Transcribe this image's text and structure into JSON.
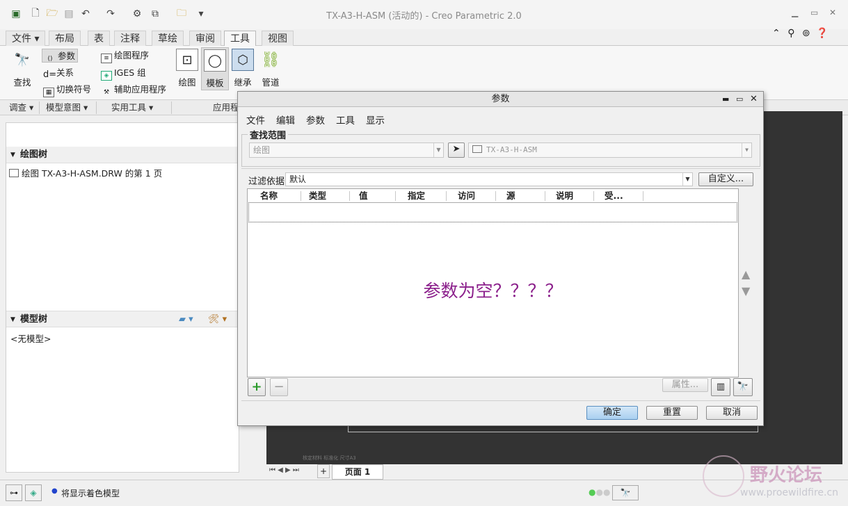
{
  "window": {
    "title": "TX-A3-H-ASM (活动的) - Creo Parametric 2.0"
  },
  "menu_tabs": [
    "文件",
    "布局",
    "表",
    "注释",
    "草绘",
    "审阅",
    "工具",
    "视图"
  ],
  "ribbon": {
    "find": "查找",
    "params": "参数",
    "relations": "关系",
    "switch_symbols": "切换符号",
    "drawing_program": "绘图程序",
    "iges_group": "IGES 组",
    "aux_apps": "辅助应用程序",
    "drawing": "绘图",
    "template": "模板",
    "inherit": "继承",
    "piping": "管道"
  },
  "groups": [
    "调查",
    "模型意图",
    "实用工具",
    "应用程"
  ],
  "left": {
    "drawing_tree_title": "绘图树",
    "drawing_tree_item": "绘图 TX-A3-H-ASM.DRW 的第 1 页",
    "model_tree_title": "模型树",
    "no_model": "<无模型>"
  },
  "page_bar": {
    "page_label": "页面 1"
  },
  "status": {
    "message": "将显示着色模型"
  },
  "watermark": {
    "site": "野火论坛",
    "url": "www.proewildfire.cn"
  },
  "canvas_note": "核定材料  标准化  尺寸A3",
  "dialog": {
    "title": "参数",
    "menus": [
      "文件",
      "编辑",
      "参数",
      "工具",
      "显示"
    ],
    "scope_legend": "查找范围",
    "scope_type": "绘图",
    "scope_object": "TX-A3-H-ASM",
    "filter_label": "过滤依据",
    "filter_value": "默认",
    "customize_button": "自定义...",
    "columns": [
      "名称",
      "类型",
      "值",
      "指定",
      "访问",
      "源",
      "说明",
      "受..."
    ],
    "empty_message": "参数为空？？？？",
    "properties_button": "属性...",
    "ok_button": "确定",
    "reset_button": "重置",
    "cancel_button": "取消"
  },
  "colors": {
    "canvas": "#333333",
    "empty_message": "#8b1f8b",
    "ok_button": "#b8d8f2",
    "watermark": "#d0a0c0"
  }
}
